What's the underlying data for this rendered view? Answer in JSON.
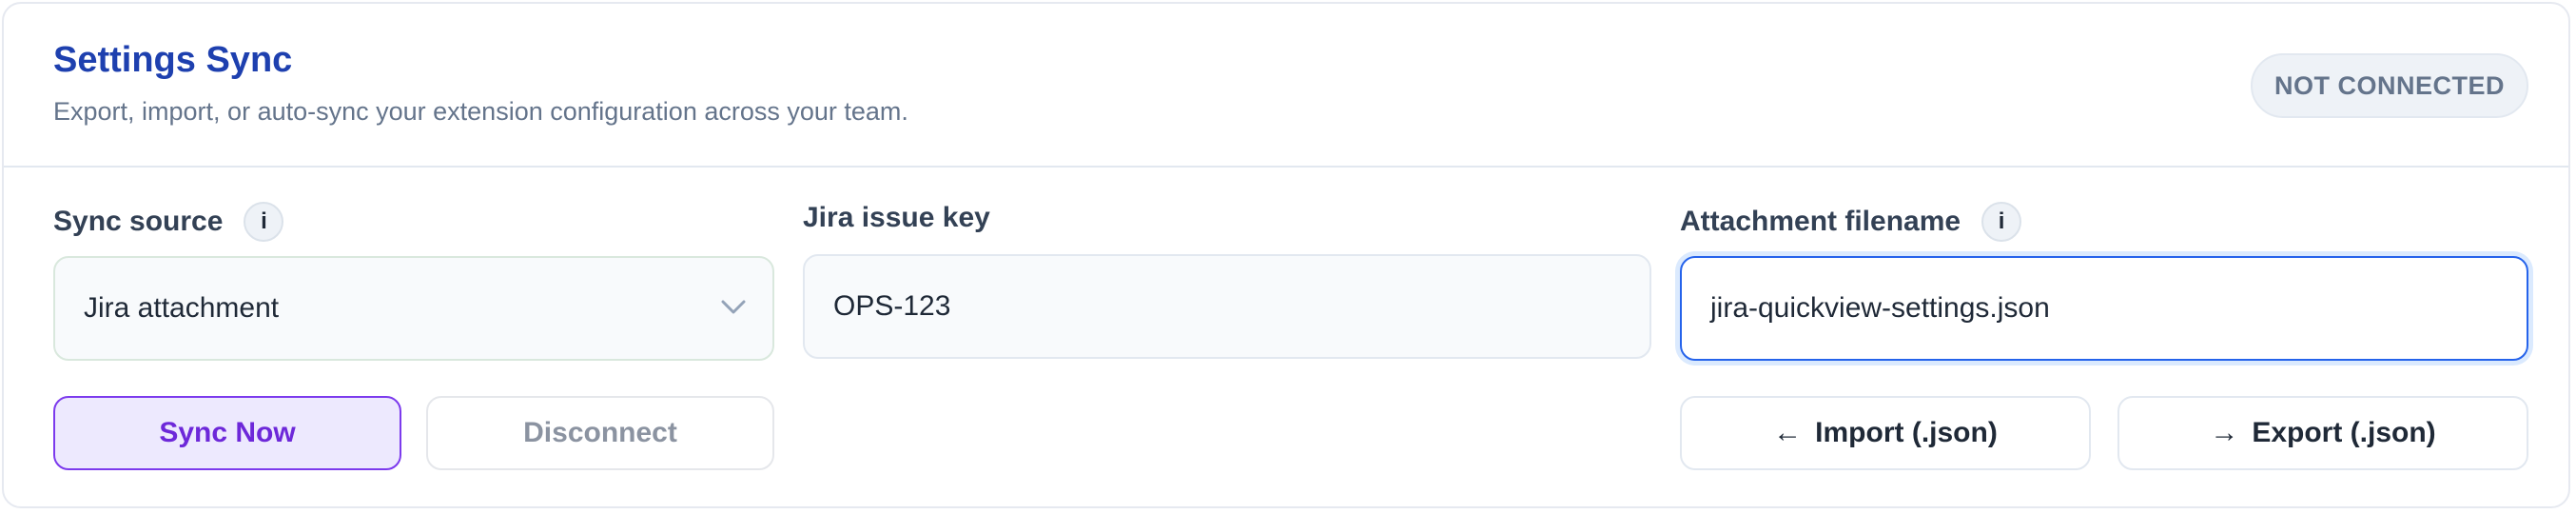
{
  "header": {
    "title": "Settings Sync",
    "subtitle": "Export, import, or auto-sync your extension configuration across your team.",
    "status_badge": "NOT CONNECTED"
  },
  "sync_source": {
    "label": "Sync source",
    "info": "i",
    "selected": "Jira attachment"
  },
  "issue_key": {
    "label": "Jira issue key",
    "value": "OPS-123"
  },
  "attachment": {
    "label": "Attachment filename",
    "info": "i",
    "value": "jira-quickview-settings.json"
  },
  "actions": {
    "sync_now": "Sync Now",
    "disconnect": "Disconnect",
    "import_arrow": "←",
    "import": "Import (.json)",
    "export_arrow": "→",
    "export": "Export (.json)"
  },
  "colors": {
    "title": "#1e40af",
    "accent": "#7c3aed",
    "focus": "#2563eb"
  }
}
